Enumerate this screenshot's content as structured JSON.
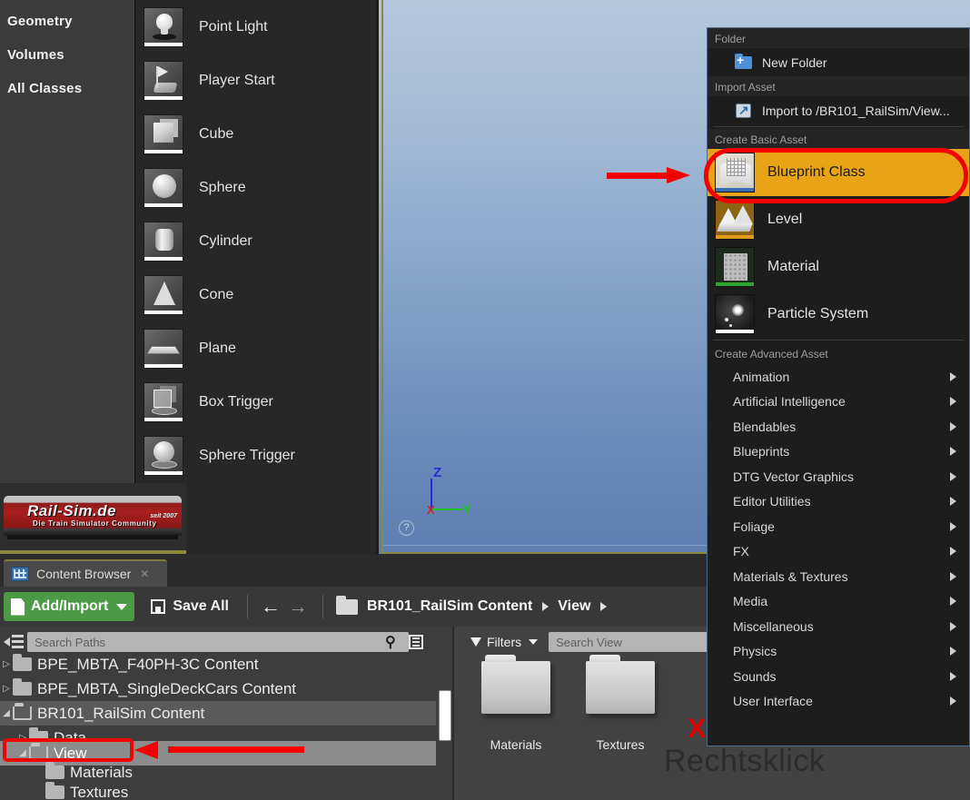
{
  "place_actors": {
    "categories": [
      {
        "label": "Geometry"
      },
      {
        "label": "Volumes"
      },
      {
        "label": "All Classes"
      }
    ],
    "items": [
      {
        "label": "Point Light",
        "icon": "point-light-icon"
      },
      {
        "label": "Player Start",
        "icon": "player-start-icon"
      },
      {
        "label": "Cube",
        "icon": "cube-icon"
      },
      {
        "label": "Sphere",
        "icon": "sphere-icon"
      },
      {
        "label": "Cylinder",
        "icon": "cylinder-icon"
      },
      {
        "label": "Cone",
        "icon": "cone-icon"
      },
      {
        "label": "Plane",
        "icon": "plane-icon"
      },
      {
        "label": "Box Trigger",
        "icon": "box-trigger-icon"
      },
      {
        "label": "Sphere Trigger",
        "icon": "sphere-trigger-icon"
      }
    ],
    "watermark": {
      "title": "Rail-Sim.de",
      "subtitle": "Die Train Simulator Community",
      "since": "seit 2007"
    }
  },
  "viewport": {
    "gizmo": {
      "z": "Z",
      "y": "Y",
      "x": "X"
    },
    "help": "?"
  },
  "context_menu": {
    "sections": {
      "folder_header": "Folder",
      "import_header": "Import Asset",
      "basic_header": "Create Basic Asset",
      "advanced_header": "Create Advanced Asset"
    },
    "folder_items": [
      {
        "label": "New Folder",
        "icon": "new-folder-icon"
      }
    ],
    "import_items": [
      {
        "label": "Import to /BR101_RailSim/View...",
        "icon": "import-asset-icon"
      }
    ],
    "basic_items": [
      {
        "label": "Blueprint Class",
        "icon": "blueprint-class-icon",
        "highlighted": true
      },
      {
        "label": "Level",
        "icon": "level-icon",
        "highlighted": false
      },
      {
        "label": "Material",
        "icon": "material-icon",
        "highlighted": false
      },
      {
        "label": "Particle System",
        "icon": "particle-system-icon",
        "highlighted": false
      }
    ],
    "advanced_items": [
      {
        "label": "Animation"
      },
      {
        "label": "Artificial Intelligence"
      },
      {
        "label": "Blendables"
      },
      {
        "label": "Blueprints"
      },
      {
        "label": "DTG Vector Graphics"
      },
      {
        "label": "Editor Utilities"
      },
      {
        "label": "Foliage"
      },
      {
        "label": "FX"
      },
      {
        "label": "Materials & Textures"
      },
      {
        "label": "Media"
      },
      {
        "label": "Miscellaneous"
      },
      {
        "label": "Physics"
      },
      {
        "label": "Sounds"
      },
      {
        "label": "User Interface"
      }
    ]
  },
  "content_browser": {
    "tab_label": "Content Browser",
    "toolbar": {
      "add_import_label": "Add/Import",
      "save_all_label": "Save All",
      "back_glyph": "←",
      "forward_glyph": "→"
    },
    "breadcrumb": [
      {
        "label": "BR101_RailSim Content"
      },
      {
        "label": "View"
      }
    ],
    "paths": {
      "search_placeholder": "Search Paths",
      "search_value": "",
      "tree": [
        {
          "label": "BPE_MBTA_F40PH-3C Content",
          "depth": 0,
          "expander": "▷",
          "selected": false
        },
        {
          "label": "BPE_MBTA_SingleDeckCars Content",
          "depth": 0,
          "expander": "▷",
          "selected": false
        },
        {
          "label": "BR101_RailSim Content",
          "depth": 0,
          "expander": "◢",
          "selected": false
        },
        {
          "label": "Data",
          "depth": 1,
          "expander": "▷",
          "selected": false
        },
        {
          "label": "View",
          "depth": 1,
          "expander": "◢",
          "selected": true
        },
        {
          "label": "Materials",
          "depth": 2,
          "expander": "",
          "selected": false
        },
        {
          "label": "Textures",
          "depth": 2,
          "expander": "",
          "selected": false
        }
      ]
    },
    "assets": {
      "filters_label": "Filters",
      "search_placeholder": "Search View",
      "search_value": "",
      "tiles": [
        {
          "label": "Materials",
          "icon": "folder-icon"
        },
        {
          "label": "Textures",
          "icon": "folder-icon"
        }
      ]
    }
  },
  "annotations": {
    "red_x": "X",
    "rechtsklick": "Rechtsklick"
  },
  "colors": {
    "highlight": "#e8a317",
    "annotation_red": "#f40000",
    "add_import_green": "#4c9a45",
    "menu_border": "#4d6b8c"
  }
}
